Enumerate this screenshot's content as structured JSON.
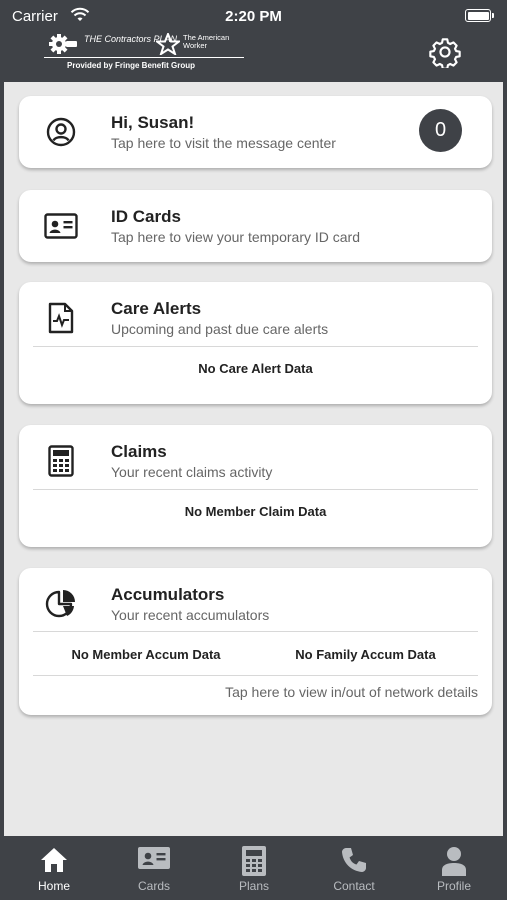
{
  "status_bar": {
    "carrier": "Carrier",
    "time": "2:20 PM"
  },
  "header": {
    "brand_primary": "THE Contractors PLAN",
    "brand_secondary": "The American Worker",
    "provided_by": "Provided by   Fringe Benefit Group"
  },
  "cards": {
    "greeting": {
      "title": "Hi, Susan!",
      "subtitle": "Tap here to visit the message center",
      "badge": "0"
    },
    "id_cards": {
      "title": "ID Cards",
      "subtitle": "Tap here to view your temporary ID card"
    },
    "care_alerts": {
      "title": "Care Alerts",
      "subtitle": "Upcoming and past due care alerts",
      "empty": "No Care Alert Data"
    },
    "claims": {
      "title": "Claims",
      "subtitle": "Your recent claims activity",
      "empty": "No Member Claim Data"
    },
    "accumulators": {
      "title": "Accumulators",
      "subtitle": "Your recent accumulators",
      "member_empty": "No Member Accum Data",
      "family_empty": "No Family Accum Data",
      "network_link": "Tap here to view in/out of network details"
    }
  },
  "tabs": [
    {
      "label": "Home",
      "icon": "home-icon",
      "active": true
    },
    {
      "label": "Cards",
      "icon": "id-card-icon",
      "active": false
    },
    {
      "label": "Plans",
      "icon": "calculator-icon",
      "active": false
    },
    {
      "label": "Contact",
      "icon": "phone-icon",
      "active": false
    },
    {
      "label": "Profile",
      "icon": "person-icon",
      "active": false
    }
  ],
  "colors": {
    "header_bg": "#3f4247",
    "page_bg": "#e8e8e8",
    "card_bg": "#ffffff",
    "tab_inactive": "#b9bcc0"
  }
}
